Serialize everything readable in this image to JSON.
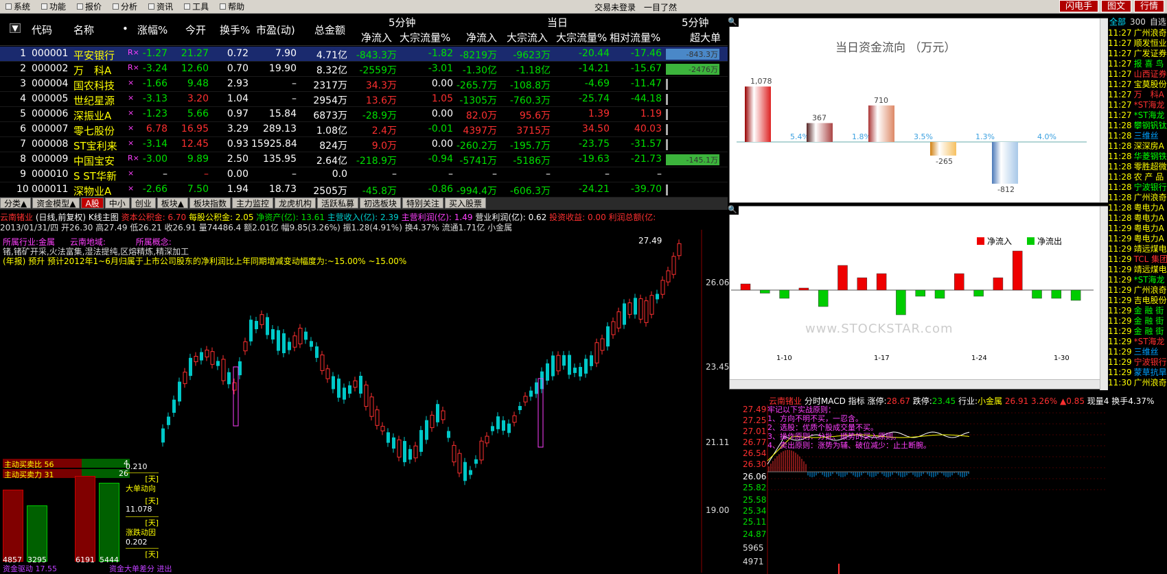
{
  "menu": {
    "items": [
      "系统",
      "功能",
      "报价",
      "分析",
      "资讯",
      "工具",
      "帮助"
    ],
    "center": "交易未登录",
    "center2": "一目了然",
    "buttons": [
      "闪电手",
      "图文",
      "行情"
    ]
  },
  "grid": {
    "headers": [
      "代码",
      "名称",
      "•",
      "涨幅%",
      "今开",
      "换手%",
      "市盈(动)",
      "总金额",
      "净流入",
      "大宗流量%",
      "净流入",
      "大宗流入",
      "大宗流量%",
      "相对流量%",
      "超大单"
    ],
    "group_headers": [
      "5分钟",
      "当日",
      "5分钟"
    ],
    "rows": [
      {
        "n": "1",
        "code": "000001",
        "name": "平安银行",
        "flag": "R×",
        "chg": "-1.27",
        "open": "21.27",
        "turn": "0.72",
        "pe": "7.90",
        "amt": "4.71亿",
        "f1": "-843.3万",
        "f2": "-1.82",
        "f3": "-8219万",
        "f4": "-9623万",
        "f5": "-20.44",
        "f6": "-17.46",
        "bar": "-843.3万"
      },
      {
        "n": "2",
        "code": "000002",
        "name": "万　科A",
        "flag": "R×",
        "chg": "-3.24",
        "open": "12.60",
        "turn": "0.70",
        "pe": "19.90",
        "amt": "8.32亿",
        "f1": "-2559万",
        "f2": "-3.01",
        "f3": "-1.30亿",
        "f4": "-1.18亿",
        "f5": "-14.21",
        "f6": "-15.67",
        "bar": "-2476万"
      },
      {
        "n": "3",
        "code": "000004",
        "name": "国农科技",
        "flag": "×",
        "chg": "-1.66",
        "open": "9.48",
        "turn": "2.93",
        "pe": "–",
        "amt": "2317万",
        "f1": "34.3万",
        "f2": "0.00",
        "f3": "-265.7万",
        "f4": "-108.8万",
        "f5": "-4.69",
        "f6": "-11.47",
        "bar": ""
      },
      {
        "n": "4",
        "code": "000005",
        "name": "世纪星源",
        "flag": "×",
        "chg": "-3.13",
        "open": "3.20",
        "turn": "1.04",
        "pe": "–",
        "amt": "2954万",
        "f1": "13.6万",
        "f2": "1.05",
        "f3": "-1305万",
        "f4": "-760.3万",
        "f5": "-25.74",
        "f6": "-44.18",
        "bar": ""
      },
      {
        "n": "5",
        "code": "000006",
        "name": "深振业A",
        "flag": "×",
        "chg": "-1.23",
        "open": "5.66",
        "turn": "0.97",
        "pe": "15.84",
        "amt": "6873万",
        "f1": "-28.9万",
        "f2": "0.00",
        "f3": "82.0万",
        "f4": "95.6万",
        "f5": "1.39",
        "f6": "1.19",
        "bar": ""
      },
      {
        "n": "6",
        "code": "000007",
        "name": "零七股份",
        "flag": "×",
        "chg": "6.78",
        "open": "16.95",
        "turn": "3.29",
        "pe": "289.13",
        "amt": "1.08亿",
        "f1": "2.4万",
        "f2": "-0.01",
        "f3": "4397万",
        "f4": "3715万",
        "f5": "34.50",
        "f6": "40.03",
        "bar": ""
      },
      {
        "n": "7",
        "code": "000008",
        "name": "ST宝利来",
        "flag": "×",
        "chg": "-3.14",
        "open": "12.45",
        "turn": "0.93",
        "pe": "15925.84",
        "amt": "824万",
        "f1": "9.0万",
        "f2": "0.00",
        "f3": "-260.2万",
        "f4": "-195.7万",
        "f5": "-23.75",
        "f6": "-31.57",
        "bar": ""
      },
      {
        "n": "8",
        "code": "000009",
        "name": "中国宝安",
        "flag": "R×",
        "chg": "-3.00",
        "open": "9.89",
        "turn": "2.50",
        "pe": "135.95",
        "amt": "2.64亿",
        "f1": "-218.9万",
        "f2": "-0.94",
        "f3": "-5741万",
        "f4": "-5186万",
        "f5": "-19.63",
        "f6": "-21.73",
        "bar": "-145.1万"
      },
      {
        "n": "9",
        "code": "000010",
        "name": "S ST华新",
        "flag": "×",
        "chg": "–",
        "open": "–",
        "turn": "0.00",
        "pe": "–",
        "amt": "0.0",
        "f1": "–",
        "f2": "–",
        "f3": "–",
        "f4": "–",
        "f5": "–",
        "f6": "–",
        "bar": ""
      },
      {
        "n": "10",
        "code": "000011",
        "name": "深物业A",
        "flag": "×",
        "chg": "-2.66",
        "open": "7.50",
        "turn": "1.94",
        "pe": "18.73",
        "amt": "2505万",
        "f1": "-45.8万",
        "f2": "-0.86",
        "f3": "-994.4万",
        "f4": "-606.3万",
        "f5": "-24.21",
        "f6": "-39.70",
        "bar": ""
      }
    ]
  },
  "tabs": [
    "分类▲",
    "资金模型▲",
    "A股",
    "中小",
    "创业",
    "板块▲",
    "板块指数",
    "主力监控",
    "龙虎机构",
    "活跃私募",
    "初选板块",
    "特别关注",
    "买入股票"
  ],
  "kline": {
    "line1_parts": [
      "云南锗业",
      "(日线,前复权)",
      "K线主图",
      "资本公积金: 6.70",
      "每股公积金: 2.05",
      "净资产(亿): 13.61",
      "主营收入(亿): 2.39",
      "主营利润(亿): 1.49",
      "营业利润(亿): 0.62",
      "投资收益: 0.00",
      "利润总额(亿:"
    ],
    "line2": "2013/01/31/四 开26.30 高27.49 低26.21 收26.91 量74486.4 额2.01亿 幅9.85(3.26%) 振1.28(4.91%) 换4.37% 流通1.71亿 小金属",
    "labels": [
      "所属行业:金属",
      "云南地域:",
      "所属概念:"
    ],
    "text1": "锗,锗矿开采,火法富集,湿法提纯,区熔精炼,精深加工",
    "text2": "(年报) 预升 预计2012年1~6月归属于上市公司股东的净利润比上年同期增减变动幅度为:~15.00% ~15.00%",
    "ylabels": [
      "26.06",
      "23.45",
      "21.11",
      "19.00"
    ],
    "hi": "27.49",
    "left_panel": {
      "l1": "主动买卖比 56",
      "l2": "主动买卖力 31",
      "v1": "4",
      "v2": "26",
      "b1": "4857",
      "b2": "3295",
      "b3": "6191",
      "b4": "5444",
      "foot1": "资金驱动 17.55",
      "foot2": "资金大单差分 进出"
    },
    "mid_labels": [
      "0.210",
      "[天]",
      "大单动向",
      "[天]",
      "11.078",
      "[天]",
      "涨跌动因",
      "0.202",
      "[天]"
    ]
  },
  "chart1": {
    "title": "当日资金流向 （万元）",
    "values": [
      1078,
      367,
      710,
      -265,
      -812
    ],
    "pcts": [
      "5.4%",
      "1.8%",
      "3.5%",
      "1.3%",
      "4.0%"
    ]
  },
  "chart2": {
    "legend_in": "净流入",
    "legend_out": "净流出",
    "xlabels": [
      "1-10",
      "1-17",
      "1-24",
      "1-30"
    ],
    "values": [
      0.3,
      -0.15,
      -0.4,
      0.1,
      -0.8,
      1.2,
      0.6,
      0.8,
      -1.2,
      -0.3,
      -0.4,
      0.8,
      -0.3,
      0.6,
      1.9,
      -0.4,
      -0.4,
      -0.5
    ]
  },
  "stocklist": {
    "tabs": [
      "全部",
      "300",
      "自选"
    ],
    "items": [
      {
        "t": "11:27",
        "n": "广州浪奇",
        "c": "#ffff00"
      },
      {
        "t": "11:27",
        "n": "顺发恒业",
        "c": "#ffff00"
      },
      {
        "t": "11:27",
        "n": "广发证券",
        "c": "#ffff00"
      },
      {
        "t": "11:27",
        "n": "报 喜 鸟",
        "c": "#00ff00"
      },
      {
        "t": "11:27",
        "n": "山西证券",
        "c": "#ff3030"
      },
      {
        "t": "11:27",
        "n": "宝莫股份",
        "c": "#ffff00"
      },
      {
        "t": "11:27",
        "n": "万　科A",
        "c": "#ff3030"
      },
      {
        "t": "11:27",
        "n": "*ST海龙",
        "c": "#ff3030"
      },
      {
        "t": "11:27",
        "n": "*ST海龙",
        "c": "#00ff00"
      },
      {
        "t": "11:28",
        "n": "攀钢钒钛",
        "c": "#00ff00"
      },
      {
        "t": "11:28",
        "n": "三维丝",
        "c": "#00a0ff"
      },
      {
        "t": "11:28",
        "n": "深深房A",
        "c": "#ffff00"
      },
      {
        "t": "11:28",
        "n": "华菱钢铁",
        "c": "#00ff00"
      },
      {
        "t": "11:28",
        "n": "零胜超微",
        "c": "#ffff00"
      },
      {
        "t": "11:28",
        "n": "农 产 品",
        "c": "#ffff00"
      },
      {
        "t": "11:28",
        "n": "宁波银行",
        "c": "#00ff00"
      },
      {
        "t": "11:28",
        "n": "广州浪奇",
        "c": "#ffff00"
      },
      {
        "t": "11:28",
        "n": "粤电力A",
        "c": "#ffff00"
      },
      {
        "t": "11:28",
        "n": "粤电力A",
        "c": "#ffff00"
      },
      {
        "t": "11:29",
        "n": "粤电力A",
        "c": "#ffff00"
      },
      {
        "t": "11:29",
        "n": "粤电力A",
        "c": "#ffff00"
      },
      {
        "t": "11:29",
        "n": "靖远煤电",
        "c": "#ffff00"
      },
      {
        "t": "11:29",
        "n": "TCL 集团",
        "c": "#ff3030"
      },
      {
        "t": "11:29",
        "n": "靖远煤电",
        "c": "#ffff00"
      },
      {
        "t": "11:29",
        "n": "*ST海龙",
        "c": "#00ff00"
      },
      {
        "t": "11:29",
        "n": "广州浪奇",
        "c": "#ffff00"
      },
      {
        "t": "11:29",
        "n": "吉电股份",
        "c": "#ffff00"
      },
      {
        "t": "11:29",
        "n": "金 融 街",
        "c": "#00ff00"
      },
      {
        "t": "11:29",
        "n": "金 融 街",
        "c": "#00ff00"
      },
      {
        "t": "11:29",
        "n": "金 融 街",
        "c": "#00ff00"
      },
      {
        "t": "11:29",
        "n": "*ST海龙",
        "c": "#ff3030"
      },
      {
        "t": "11:29",
        "n": "三维丝",
        "c": "#00a0ff"
      },
      {
        "t": "11:29",
        "n": "宁波银行",
        "c": "#ff3030"
      },
      {
        "t": "11:29",
        "n": "蒙草抗旱",
        "c": "#00a0ff"
      },
      {
        "t": "11:30",
        "n": "广州浪奇",
        "c": "#ffff00"
      }
    ]
  },
  "minute": {
    "header": [
      "云南锗业",
      "分时MACD",
      "指标",
      "涨停:",
      "28.67",
      "跌停:",
      "23.45",
      "行业:",
      "小金属",
      "26.91",
      "3.26%",
      "▲0.85",
      "现量",
      "4",
      "换手",
      "4.37%"
    ],
    "tips": [
      "牢记以下实战原则：",
      "1、方向不明不买，一忍含。",
      "2、选股：优质个股成交量不买。",
      "3、操作原则：分批、顺势的买入原则。",
      "4、卖出原则：涨势为辅、破位减少：止土断腕。"
    ],
    "ylabels": [
      "27.49",
      "27.25",
      "27.01",
      "26.77",
      "26.54",
      "26.30",
      "26.06",
      "25.82",
      "25.58",
      "25.34",
      "25.11",
      "24.87",
      "5965",
      "4971"
    ]
  },
  "watermark": "www.STOCKSTAR.com"
}
